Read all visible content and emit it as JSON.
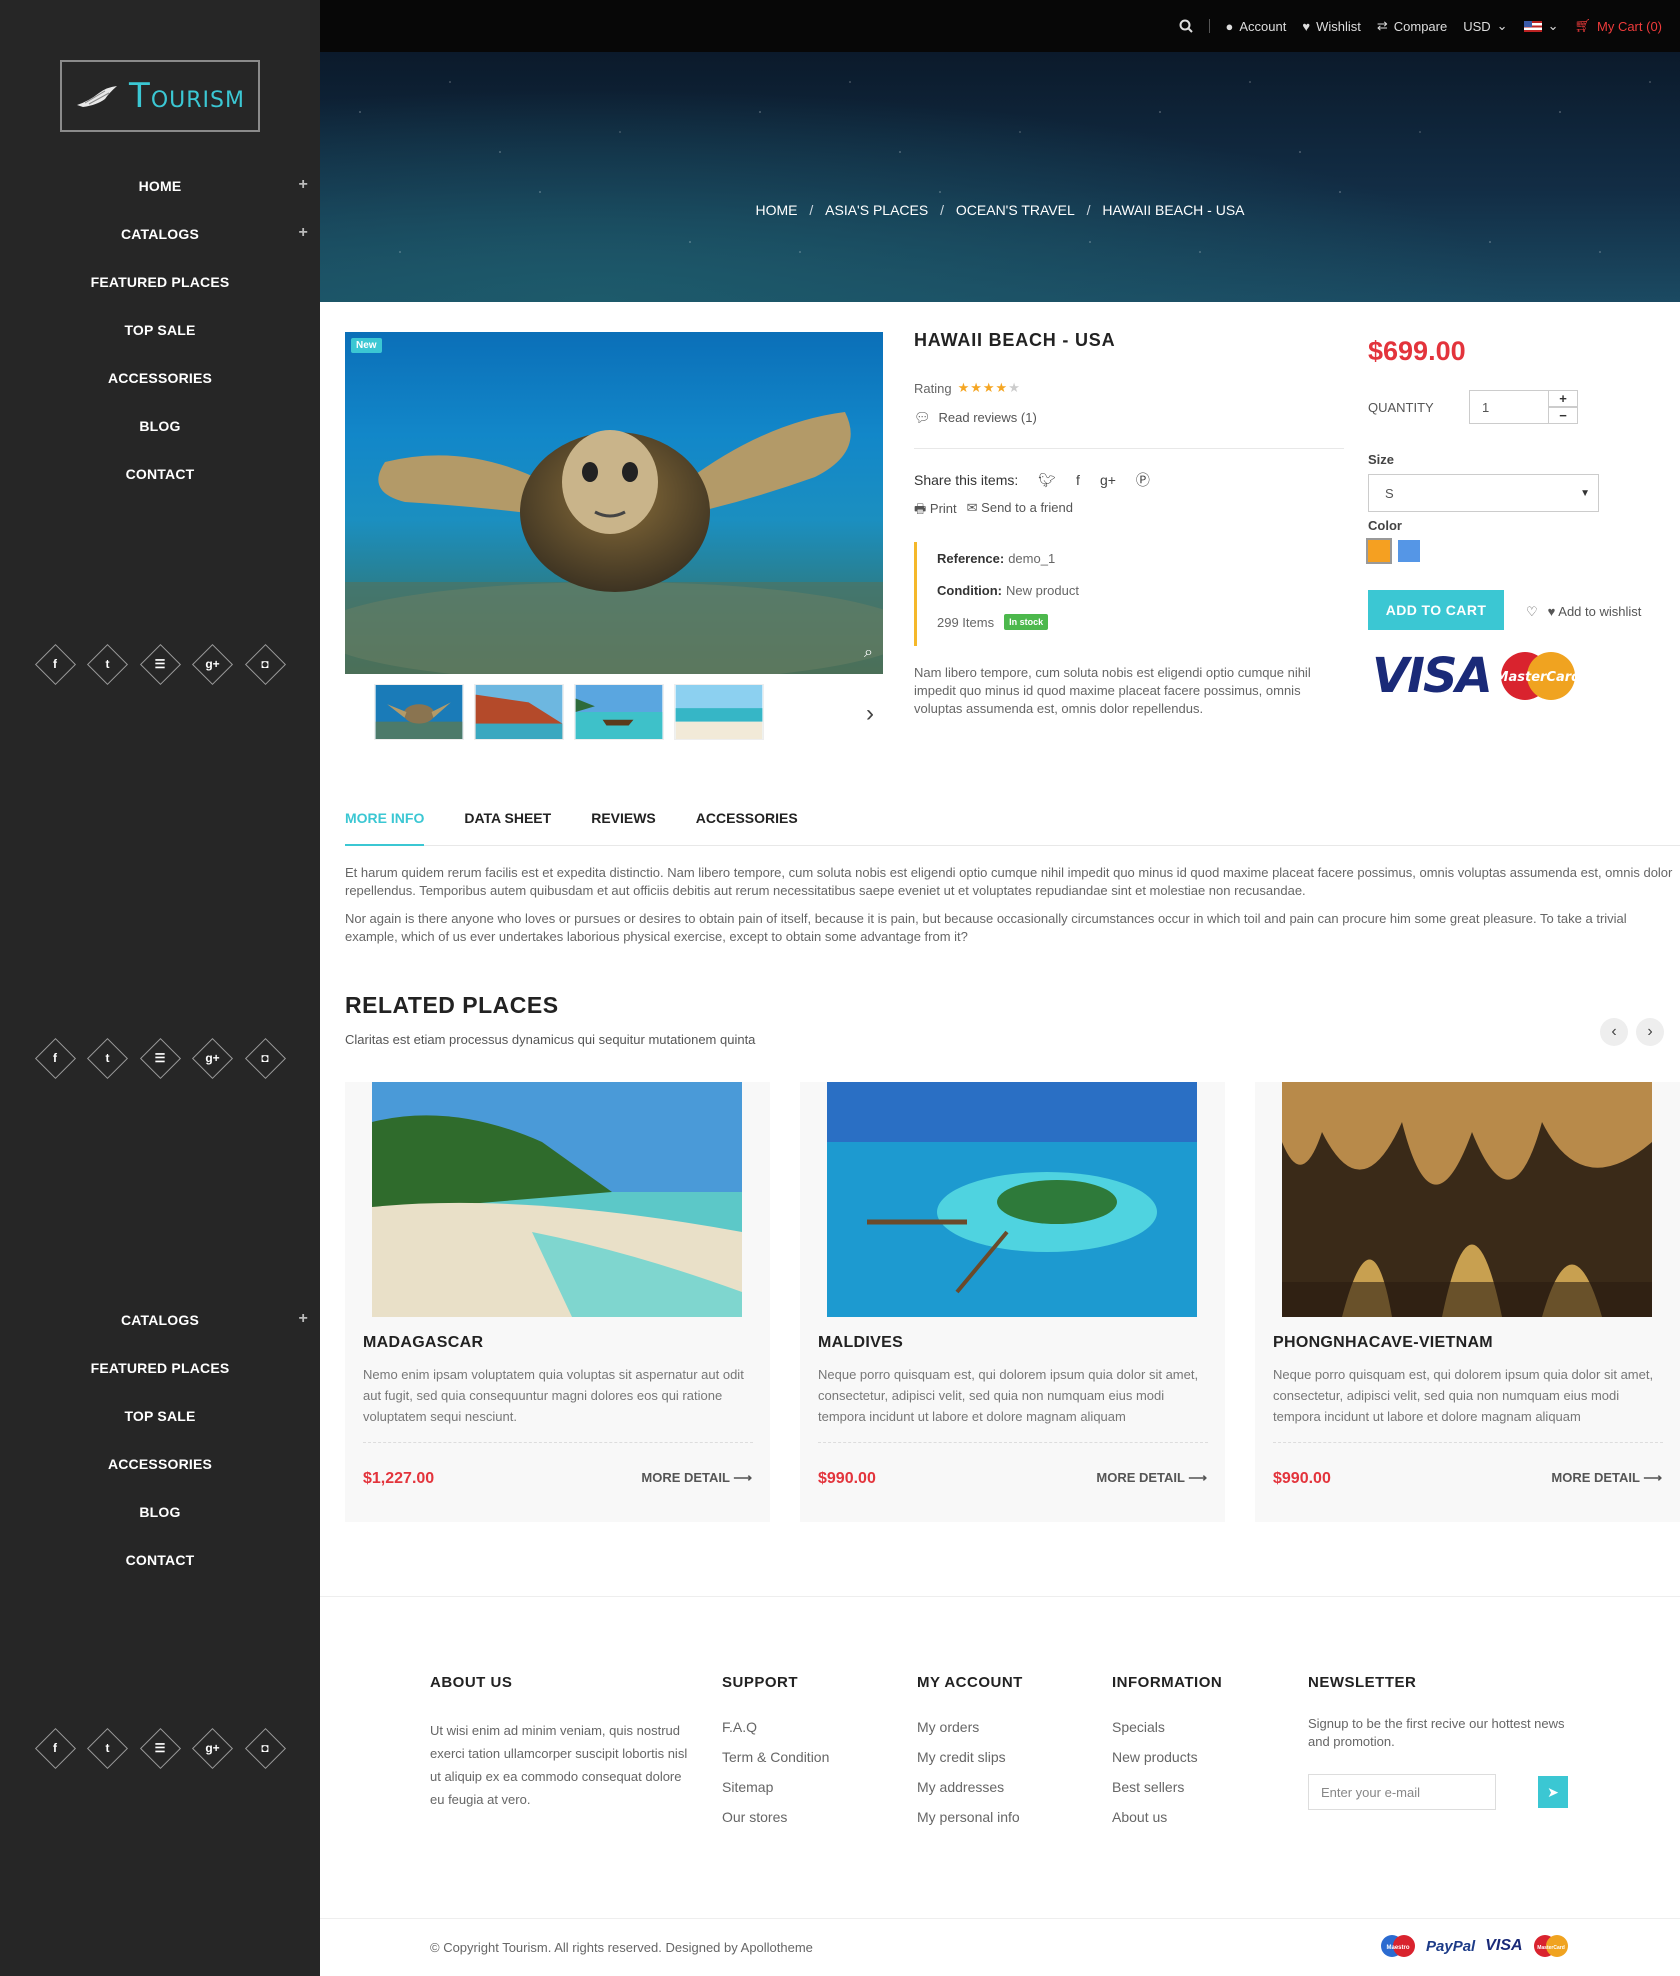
{
  "brand": {
    "logo_initial": "T",
    "logo_rest": "OURISM"
  },
  "sidebar": {
    "menu_top": [
      {
        "label": "HOME",
        "plus": "+"
      },
      {
        "label": "CATALOGS",
        "plus": "+"
      },
      {
        "label": "FEATURED PLACES",
        "plus": ""
      },
      {
        "label": "TOP SALE",
        "plus": ""
      },
      {
        "label": "ACCESSORIES",
        "plus": ""
      },
      {
        "label": "BLOG",
        "plus": ""
      },
      {
        "label": "CONTACT",
        "plus": ""
      }
    ],
    "menu_bottom": [
      {
        "label": "CATALOGS",
        "plus": "+"
      },
      {
        "label": "FEATURED PLACES",
        "plus": ""
      },
      {
        "label": "TOP SALE",
        "plus": ""
      },
      {
        "label": "ACCESSORIES",
        "plus": ""
      },
      {
        "label": "BLOG",
        "plus": ""
      },
      {
        "label": "CONTACT",
        "plus": ""
      }
    ],
    "social": [
      {
        "icon": "facebook-icon",
        "glyph": "f"
      },
      {
        "icon": "twitter-icon",
        "glyph": "t"
      },
      {
        "icon": "rss-icon",
        "glyph": "☰"
      },
      {
        "icon": "google-plus-icon",
        "glyph": "g+"
      },
      {
        "icon": "instagram-icon",
        "glyph": "◘"
      }
    ]
  },
  "topbar": {
    "account": "Account",
    "wishlist": "Wishlist",
    "compare": "Compare",
    "currency": "USD",
    "cart": "My Cart (0)"
  },
  "breadcrumb": [
    "HOME",
    "ASIA'S PLACES",
    "OCEAN'S TRAVEL",
    "HAWAII BEACH - USA"
  ],
  "product": {
    "badge": "New",
    "title": "HAWAII BEACH - USA",
    "rating_label": "Rating",
    "rating": 4,
    "rating_max": 5,
    "reviews": "Read reviews (1)",
    "share_label": "Share this items:",
    "print": "Print",
    "send": "Send to a friend",
    "reference_label": "Reference:",
    "reference": "demo_1",
    "condition_label": "Condition:",
    "condition": "New product",
    "items": "299 Items",
    "stock": "In stock",
    "description": "Nam libero tempore, cum soluta nobis est eligendi optio cumque nihil impedit quo minus id quod maxime placeat facere possimus, omnis voluptas assumenda est, omnis dolor repellendus.",
    "price": "$699.00",
    "quantity_label": "QUANTITY",
    "quantity": "1",
    "size_label": "Size",
    "size": "S",
    "color_label": "Color",
    "colors": [
      "#f5a021",
      "#5596e6"
    ],
    "add_to_cart": "ADD TO CART",
    "add_to_wishlist": "Add to wishlist",
    "visa": "VISA",
    "mastercard": "MasterCard"
  },
  "tabs": [
    "MORE INFO",
    "DATA SHEET",
    "REVIEWS",
    "ACCESSORIES"
  ],
  "tab_content": [
    "Et harum quidem rerum facilis est et expedita distinctio. Nam libero tempore, cum soluta nobis est eligendi optio cumque nihil impedit quo minus id quod maxime placeat facere possimus, omnis voluptas assumenda est, omnis dolor repellendus. Temporibus autem quibusdam et aut officiis debitis aut rerum necessitatibus saepe eveniet ut et voluptates repudiandae sint et molestiae non recusandae.",
    "Nor again is there anyone who loves or pursues or desires to obtain pain of itself, because it is pain, but because occasionally circumstances occur in which toil and pain can procure him some great pleasure. To take a trivial example, which of us ever undertakes laborious physical exercise, except to obtain some advantage from it?"
  ],
  "related": {
    "title": "RELATED PLACES",
    "subtitle": "Claritas est etiam processus dynamicus qui sequitur mutationem quinta",
    "items": [
      {
        "name": "MADAGASCAR",
        "text": "Nemo enim ipsam voluptatem quia voluptas sit aspernatur aut odit aut fugit, sed quia consequuntur magni dolores eos qui ratione voluptatem sequi nesciunt.",
        "price": "$1,227.00",
        "more": "MORE DETAIL ⟶"
      },
      {
        "name": "MALDIVES",
        "text": "Neque porro quisquam est, qui dolorem ipsum quia dolor sit amet, consectetur, adipisci velit, sed quia non numquam eius modi tempora incidunt ut labore et dolore magnam aliquam",
        "price": "$990.00",
        "more": "MORE DETAIL ⟶"
      },
      {
        "name": "PHONGNHACAVE-VIETNAM",
        "text": "Neque porro quisquam est, qui dolorem ipsum quia dolor sit amet, consectetur, adipisci velit, sed quia non numquam eius modi tempora incidunt ut labore et dolore magnam aliquam",
        "price": "$990.00",
        "more": "MORE DETAIL ⟶"
      }
    ]
  },
  "footer": {
    "about_title": "ABOUT US",
    "about_text": "Ut wisi enim ad minim veniam, quis nostrud exerci tation ullamcorper suscipit lobortis nisl ut aliquip ex ea commodo consequat dolore eu feugia at vero.",
    "support_title": "SUPPORT",
    "support": [
      "F.A.Q",
      "Term & Condition",
      "Sitemap",
      "Our stores"
    ],
    "account_title": "MY ACCOUNT",
    "account": [
      "My orders",
      "My credit slips",
      "My addresses",
      "My personal info"
    ],
    "info_title": "INFORMATION",
    "info": [
      "Specials",
      "New products",
      "Best sellers",
      "About us"
    ],
    "news_title": "NEWSLETTER",
    "news_text": "Signup to be the first recive our hottest news and promotion.",
    "news_placeholder": "Enter your e-mail",
    "copyright": "© Copyright Tourism. All rights reserved. Designed by Apollotheme",
    "pay": {
      "maestro": "Maestro",
      "paypal": "PayPal",
      "visa": "VISA",
      "mastercard": "MasterCard"
    }
  }
}
